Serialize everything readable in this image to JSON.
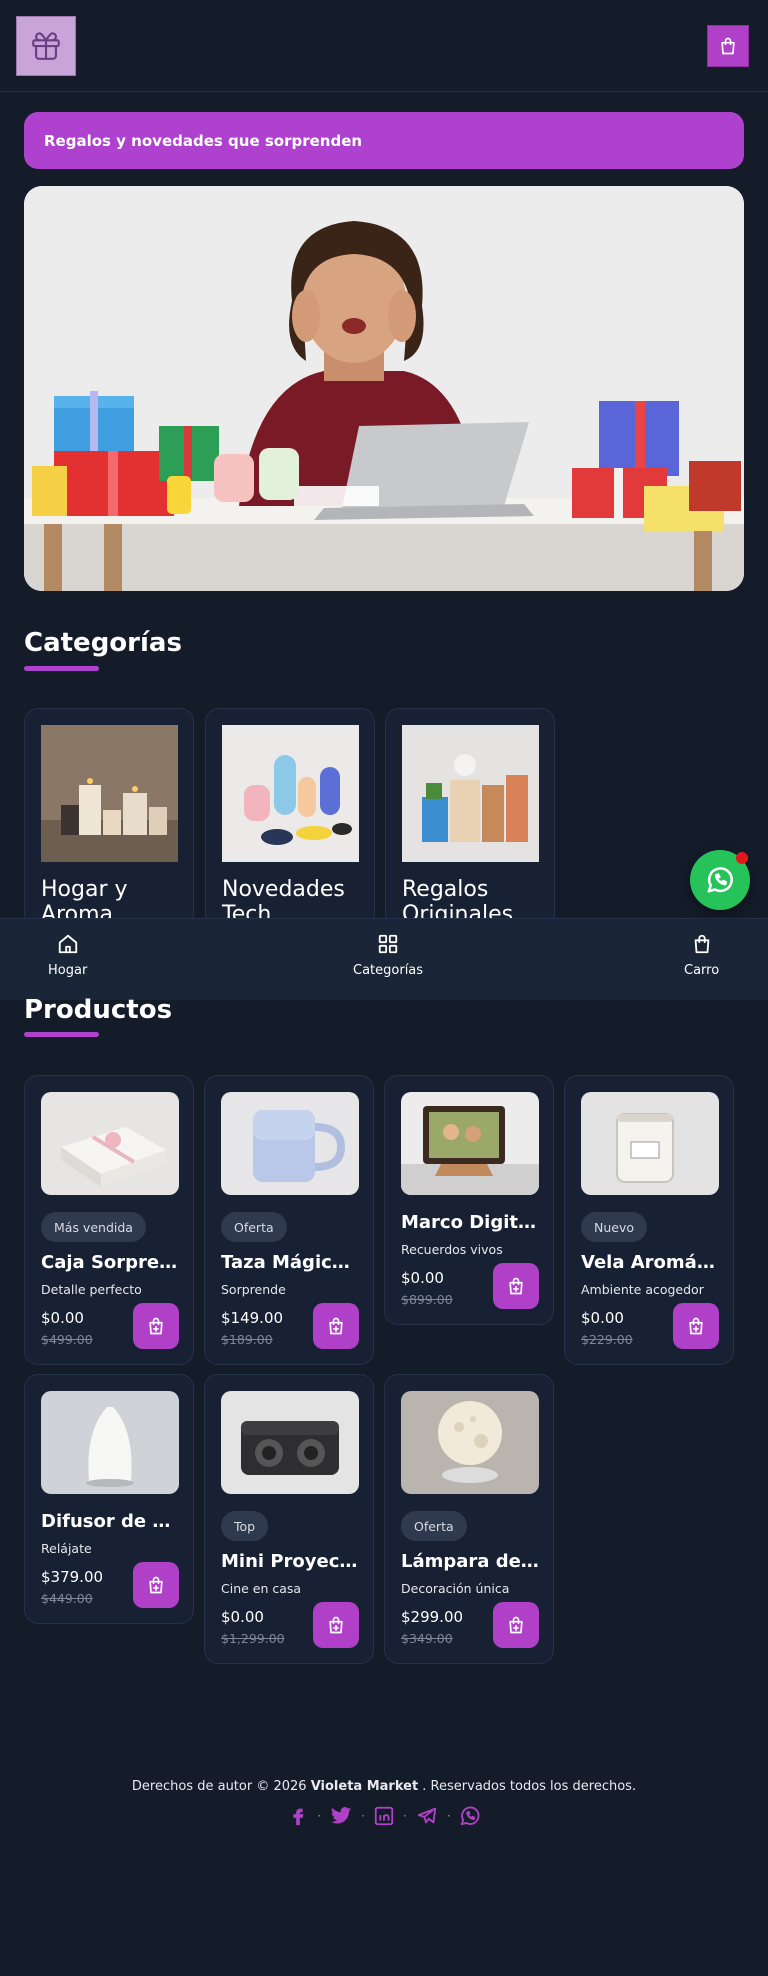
{
  "header": {
    "logo_icon": "gift-icon",
    "cart_icon": "shopping-bag-icon"
  },
  "banner": {
    "text": "Regalos y novedades que sorprenden"
  },
  "categories_section": {
    "title": "Categorías",
    "items": [
      {
        "name": "Hogar y Aroma"
      },
      {
        "name": "Novedades Tech"
      },
      {
        "name": "Regalos Originales"
      }
    ]
  },
  "bottom_nav": {
    "items": [
      {
        "label": "Hogar",
        "icon": "home-icon"
      },
      {
        "label": "Categorías",
        "icon": "grid-icon"
      },
      {
        "label": "Carro",
        "icon": "shopping-bag-icon"
      }
    ]
  },
  "products_section": {
    "title": "Productos",
    "items": [
      {
        "badge": "Más vendida",
        "name": "Caja Sorpresa...",
        "subtitle": "Detalle perfecto",
        "price": "$0.00",
        "old_price": "$499.00"
      },
      {
        "badge": "Oferta",
        "name": "Taza Mágica q...",
        "subtitle": "Sorprende",
        "price": "$149.00",
        "old_price": "$189.00"
      },
      {
        "badge": "",
        "name": "Marco Digital ...",
        "subtitle": "Recuerdos vivos",
        "price": "$0.00",
        "old_price": "$899.00"
      },
      {
        "badge": "Nuevo",
        "name": "Vela Aromátic...",
        "subtitle": "Ambiente acogedor",
        "price": "$0.00",
        "old_price": "$229.00"
      },
      {
        "badge": "",
        "name": "Difusor de Ar...",
        "subtitle": "Relájate",
        "price": "$379.00",
        "old_price": "$449.00"
      },
      {
        "badge": "Top",
        "name": "Mini Proyecto...",
        "subtitle": "Cine en casa",
        "price": "$0.00",
        "old_price": "$1,299.00"
      },
      {
        "badge": "Oferta",
        "name": "Lámpara de L...",
        "subtitle": "Decoración única",
        "price": "$299.00",
        "old_price": "$349.00"
      }
    ]
  },
  "footer": {
    "prefix": "Derechos de autor © 2026",
    "brand": "Violeta Market",
    "suffix": ". Reservados todos los derechos.",
    "socials": [
      "facebook-icon",
      "twitter-icon",
      "linkedin-icon",
      "telegram-icon",
      "whatsapp-icon"
    ]
  },
  "colors": {
    "background": "#141c2a",
    "card": "#172133",
    "accent": "#ae42ce",
    "whatsapp": "#25c35a"
  }
}
